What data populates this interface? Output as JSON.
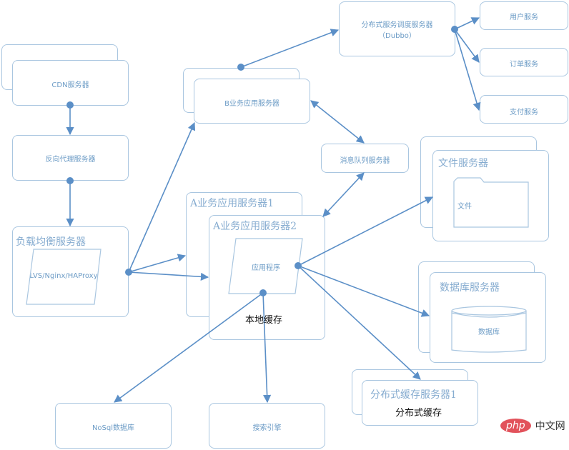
{
  "nodes": {
    "cdn": "CDN服务器",
    "reverse_proxy": "反向代理服务器",
    "load_balancer": "负载均衡服务器",
    "load_balancer_inner": "LVS/Nginx/HAProxy",
    "b_app": "B业务应用服务器",
    "dubbo_line1": "分布式服务调度服务器",
    "dubbo_line2": "（Dubbo）",
    "user_service": "用户服务",
    "order_service": "订单服务",
    "pay_service": "支付服务",
    "mq": "消息队列服务器",
    "file_server": "文件服务器",
    "file_inner": "文件",
    "a_app1": "A业务应用服务器1",
    "a_app2": "A业务应用服务器2",
    "app_program": "应用程序",
    "local_cache": "本地缓存",
    "db_server": "数据库服务器",
    "db_inner": "数据库",
    "cache_server": "分布式缓存服务器1",
    "cache_inner": "分布式缓存",
    "nosql": "NoSql数据库",
    "search": "搜索引擎"
  },
  "watermark": {
    "brand": "php",
    "suffix": "中文网"
  },
  "colors": {
    "line": "#5b8fc7",
    "border": "#a9c6e0",
    "text": "#6d9cc6",
    "watermark": "#e2525b"
  }
}
